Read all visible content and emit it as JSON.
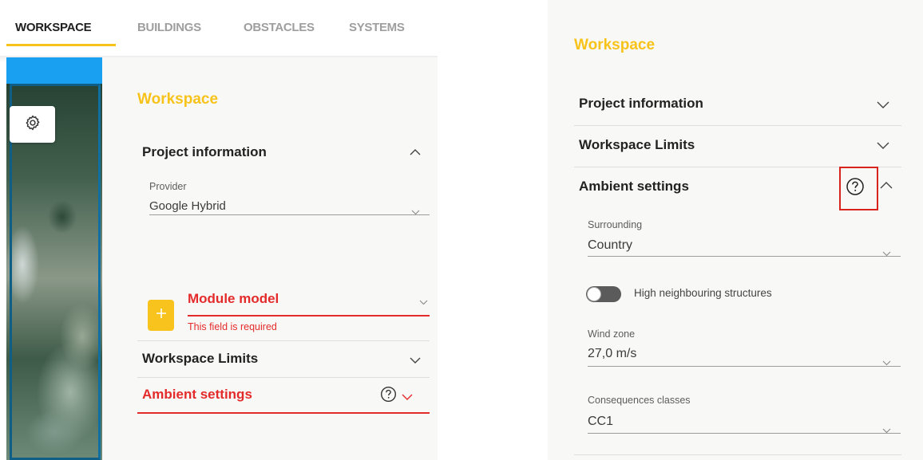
{
  "tabs": [
    "WORKSPACE",
    "BUILDINGS",
    "OBSTACLES",
    "SYSTEMS"
  ],
  "colors": {
    "accent": "#f7c31b",
    "error": "#e42b2b",
    "map_bar": "#19a0f0",
    "highlight": "#d9231d"
  },
  "left": {
    "title": "Workspace",
    "project_information": {
      "label": "Project information",
      "provider_label": "Provider",
      "provider_value": "Google Hybrid"
    },
    "module_model": {
      "label": "Module model",
      "error": "This field is required",
      "add_icon": "plus-icon"
    },
    "workspace_limits": {
      "label": "Workspace Limits"
    },
    "ambient_settings": {
      "label": "Ambient settings"
    },
    "map_settings_icon": "gear-icon"
  },
  "right": {
    "title": "Workspace",
    "project_information": {
      "label": "Project information"
    },
    "workspace_limits": {
      "label": "Workspace Limits"
    },
    "ambient_settings": {
      "label": "Ambient settings",
      "surrounding_label": "Surrounding",
      "surrounding_value": "Country",
      "high_neighbouring_label": "High neighbouring structures",
      "high_neighbouring_enabled": false,
      "wind_zone_label": "Wind zone",
      "wind_zone_value": "27,0 m/s",
      "consequences_label": "Consequences classes",
      "consequences_value": "CC1"
    },
    "help_icon": "help-circle-icon"
  }
}
